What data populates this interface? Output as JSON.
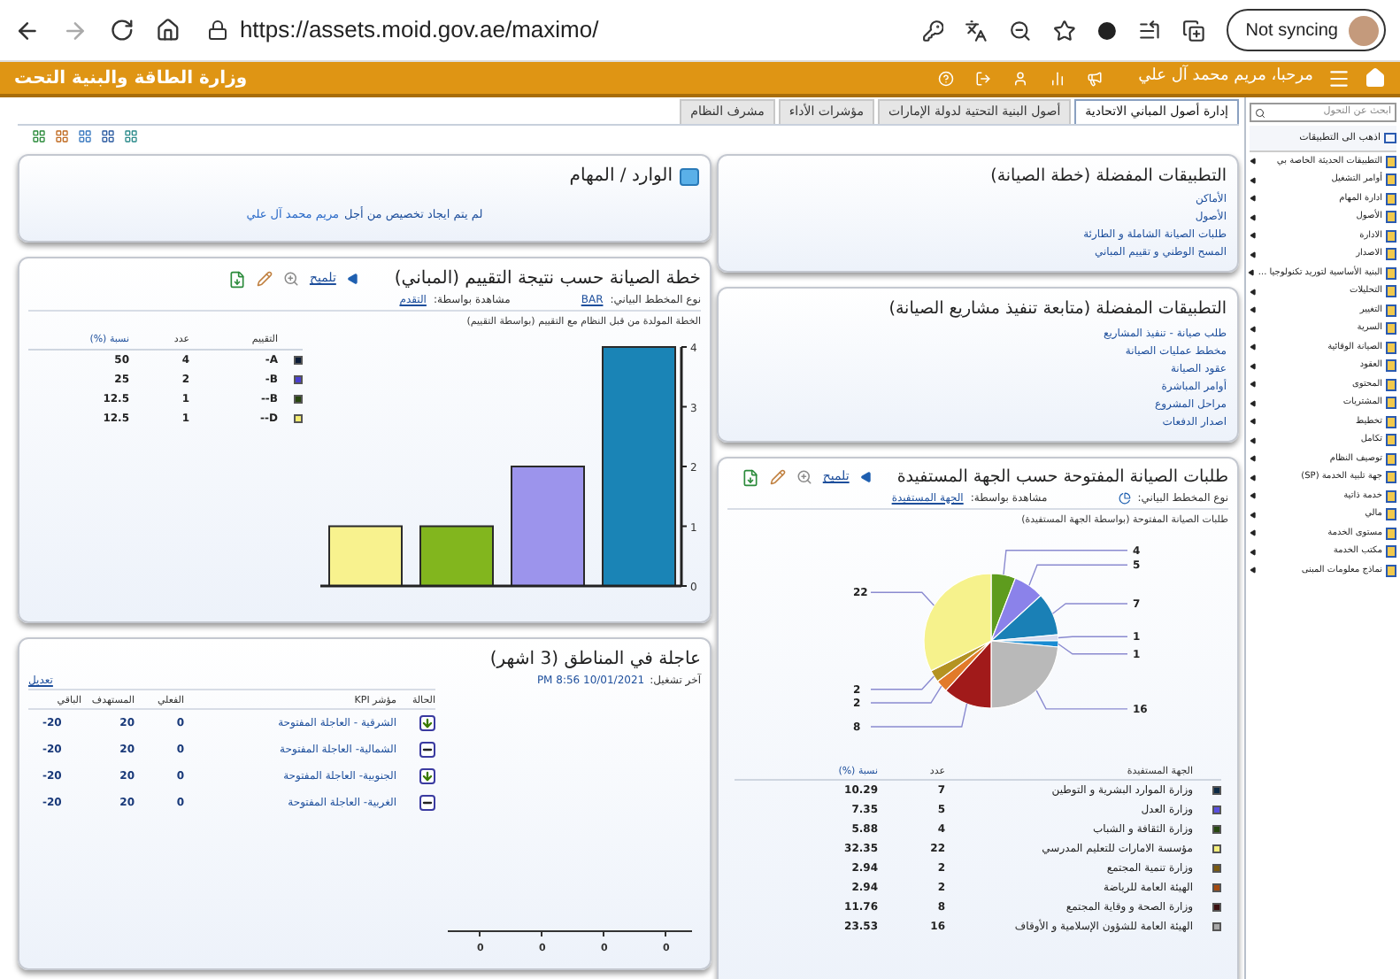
{
  "browser": {
    "url": "https://assets.moid.gov.ae/maximo/",
    "sync_button": "Not syncing"
  },
  "header": {
    "title": "وزارة الطاقة والبنية التحت",
    "welcome": "مرحبا، مريم محمد آل علي"
  },
  "tabs": [
    {
      "label": "إدارة أصول المباني الاتحادية",
      "selected": true
    },
    {
      "label": "أصول البنية التحتية لدولة الإمارات",
      "selected": false
    },
    {
      "label": "مؤشرات الأداء",
      "selected": false
    },
    {
      "label": "مشرف النظام",
      "selected": false
    }
  ],
  "inbox": {
    "title": "الوارد / المهام",
    "message": "لم يتم ايجاد تخصيص من أجل",
    "user_link": "مريم محمد آل علي"
  },
  "rating_chart": {
    "title": "خطة الصيانة حسب نتيجة التقييم (المباني)",
    "hint_link": "تلميح",
    "chart_type_label": "نوع المخطط البياني:",
    "chart_type": "BAR",
    "view_by_label": "مشاهدة بواسطة:",
    "view_by": "التقدم",
    "subtitle": "الخطة المولدة من قبل النظام مع التقييم (بواسطة التقييم)",
    "chart_data": {
      "type": "bar",
      "values": [
        1,
        1,
        2,
        4
      ],
      "colors": [
        "#f8f28e",
        "#82b61e",
        "#9c94ec",
        "#1a84b6"
      ],
      "yticks": [
        0,
        1,
        2,
        3,
        4
      ],
      "ylim": [
        0,
        4
      ]
    },
    "legend_columns": [
      "التقييم",
      "عدد",
      "نسبة (%)"
    ],
    "legend": [
      {
        "rating": "-A",
        "count": "4",
        "ratio": "50",
        "color": "#0c1c36"
      },
      {
        "rating": "-B",
        "count": "2",
        "ratio": "25",
        "color": "#4b3fd0"
      },
      {
        "rating": "--B",
        "count": "1",
        "ratio": "12.5",
        "color": "#28450e"
      },
      {
        "rating": "--D",
        "count": "1",
        "ratio": "12.5",
        "color": "#f4ec70"
      }
    ]
  },
  "kpi": {
    "title": "عاجلة في المناطق (3 اشهر)",
    "last_run_label": "آخر تشغيل:",
    "last_run": "PM 8:56 10/01/2021",
    "edit_link": "تعديل",
    "columns": [
      "الحالة",
      "مؤشر KPI",
      "الفعلي",
      "المستهدف",
      "الباقي"
    ],
    "rows": [
      {
        "kind": "down",
        "name": "الشرقية - العاجلة المفتوحة",
        "actual": "0",
        "target": "20",
        "remaining": "-20"
      },
      {
        "kind": "flat",
        "name": "الشمالية- العاجلة المفتوحة",
        "actual": "0",
        "target": "20",
        "remaining": "-20"
      },
      {
        "kind": "down",
        "name": "الجنوبية- العاجلة المفتوحة",
        "actual": "0",
        "target": "20",
        "remaining": "-20"
      },
      {
        "kind": "flat",
        "name": "الغربية- العاجلة المفتوحة",
        "actual": "0",
        "target": "20",
        "remaining": "-20"
      }
    ],
    "axis_labels": [
      "0",
      "0",
      "0",
      "0"
    ]
  },
  "favorites": [
    {
      "title": "التطبيقات المفضلة (خطة الصيانة)",
      "links": [
        "الأماكن",
        "الأصول",
        "طلبات الصيانة الشاملة و الطارئة",
        "المسح الوطني و تقييم المباني"
      ]
    },
    {
      "title": "التطبيقات المفضلة (متابعة تنفيذ مشاريع الصيانة)",
      "links": [
        "طلب صيانة - تنفيذ المشاريع",
        "مخطط عمليات الصيانة",
        "عقود الصيانة",
        "أوامر المباشرة",
        "مراحل المشروع",
        "اصدار الدفعات"
      ]
    }
  ],
  "requests_chart": {
    "title": "طلبات الصيانة المفتوحة حسب الجهة المستفيدة",
    "hint_link": "تلميح",
    "chart_type_label": "نوع المخطط البياني:",
    "view_by_label": "مشاهدة بواسطة:",
    "view_by": "الجهة المستفيدة",
    "subtitle": "طلبات الصيانة المفتوحة (بواسطة الجهة المستفيدة)",
    "chart_data": {
      "type": "pie",
      "values": [
        4,
        5,
        7,
        1,
        1,
        16,
        8,
        2,
        2,
        22
      ],
      "colors": [
        "#5e9c1e",
        "#8b82ea",
        "#1a80b6",
        "#d8dcef",
        "#1a8cd2",
        "#b9b9b9",
        "#a11a1a",
        "#e27a2a",
        "#b49322",
        "#f6f28c"
      ],
      "data_labels": true
    },
    "legend_columns": [
      "الجهة المستفيدة",
      "عدد",
      "نسبة (%)"
    ],
    "legend": [
      {
        "name": "وزارة الموارد البشرية و التوطين",
        "count": "7",
        "ratio": "10.29",
        "color": "#0d2a45"
      },
      {
        "name": "وزارة العدل",
        "count": "5",
        "ratio": "7.35",
        "color": "#5a4fe0"
      },
      {
        "name": "وزارة الثقافة و الشباب",
        "count": "4",
        "ratio": "5.88",
        "color": "#274810"
      },
      {
        "name": "مؤسسة الامارات للتعليم المدرسي",
        "count": "22",
        "ratio": "32.35",
        "color": "#f3ee7c"
      },
      {
        "name": "وزارة تنمية المجتمع",
        "count": "2",
        "ratio": "2.94",
        "color": "#7a5a10"
      },
      {
        "name": "الهيئة العامة للرياضة",
        "count": "2",
        "ratio": "2.94",
        "color": "#a44a10"
      },
      {
        "name": "وزارة الصحة و وقاية المجتمع",
        "count": "8",
        "ratio": "11.76",
        "color": "#3a0f10"
      },
      {
        "name": "الهيئة العامة للشؤون الإسلامية و الأوقاف",
        "count": "16",
        "ratio": "23.53",
        "color": "#a8a8a8"
      }
    ]
  },
  "sidebar": {
    "search_placeholder": "ابحث عن التحول",
    "go_to": "اذهب الى التطبيقات",
    "items": [
      "التطبيقات الحديثة الخاصة بي",
      "أوامر التشغيل",
      "ادارة المهام",
      "الأصول",
      "الادارة",
      "الاصدار",
      "البنية الأساسية لتوريد تكنولوجيا ...",
      "التحليلات",
      "التغيير",
      "السرية",
      "الصيانة الوقائية",
      "العقود",
      "المحتوى",
      "المشتريات",
      "تخطيط",
      "تكامل",
      "توصيف النظام",
      "جهة تلبية الخدمة (SP)",
      "خدمة ذاتية",
      "مالي",
      "مستوى الخدمة",
      "مكتب الخدمة",
      "نماذج معلومات المبنى"
    ]
  }
}
